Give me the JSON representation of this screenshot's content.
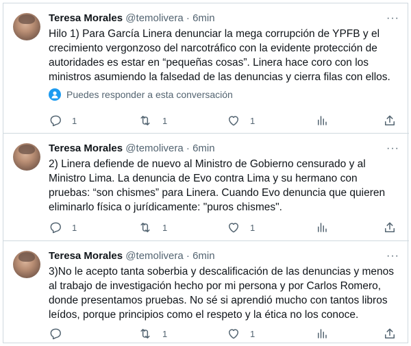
{
  "tweets": [
    {
      "author_name": "Teresa Morales",
      "handle": "@temolivera",
      "separator": "·",
      "time": "6min",
      "text": "Hilo 1) Para García Linera denunciar la mega corrupción de YPFB y el crecimiento vergonzoso del narcotráfico con la evidente protección de autoridades es estar en “pequeñas cosas”. Linera hace coro con los ministros asumiendo la falsedad de las denuncias y cierra filas con ellos.",
      "reply_hint": "Puedes responder a esta conversación",
      "replies": "1",
      "retweets": "1",
      "likes": "1"
    },
    {
      "author_name": "Teresa Morales",
      "handle": "@temolivera",
      "separator": "·",
      "time": "6min",
      "text": "2) Linera defiende de nuevo al Ministro de Gobierno censurado y al Ministro Lima. La denuncia de Evo contra Lima y su hermano con pruebas: “son chismes” para Linera. Cuando Evo denuncia que quieren eliminarlo física o jurídicamente: \"puros chismes\".",
      "replies": "1",
      "retweets": "1",
      "likes": "1"
    },
    {
      "author_name": "Teresa Morales",
      "handle": "@temolivera",
      "separator": "·",
      "time": "6min",
      "text": "3)No le acepto tanta soberbia y descalificación de las denuncias y menos al trabajo de investigación hecho por mi persona y por Carlos Romero, donde presentamos pruebas. No sé si aprendió mucho con tantos libros leídos, porque principios como el respeto y la ética no los conoce.",
      "replies": "",
      "retweets": "1",
      "likes": "1"
    }
  ],
  "icons": {
    "more": "more-icon",
    "reply": "reply-icon",
    "retweet": "retweet-icon",
    "like": "like-icon",
    "views": "views-icon",
    "share": "share-icon",
    "reply_hint": "person-icon"
  },
  "colors": {
    "text": "#0f1419",
    "secondary": "#536471",
    "accent": "#1d9bf0",
    "border": "#cfd9de"
  }
}
